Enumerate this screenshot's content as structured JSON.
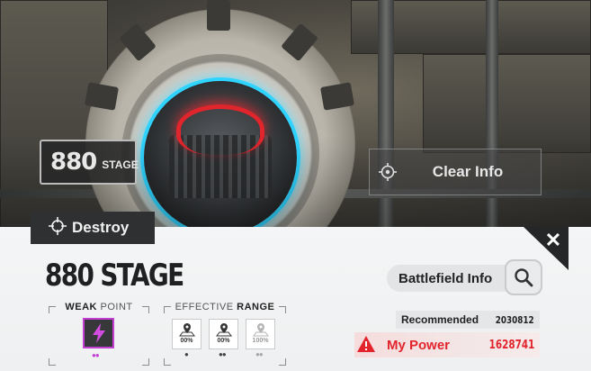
{
  "stage": {
    "number": "880",
    "badge_label": "STAGE",
    "title": "880 STAGE"
  },
  "clear_info": {
    "label": "Clear Info",
    "icon": "crosshair-icon"
  },
  "mode": {
    "label": "Destroy",
    "icon": "target-reticle-icon"
  },
  "close": {
    "label": "✕"
  },
  "weak_point": {
    "title_a": "WEAK",
    "title_b": "POINT",
    "icon": "lightning-icon",
    "accent": "#c33fd3",
    "people": "2"
  },
  "effective_range": {
    "title_a": "EFFECTIVE",
    "title_b": "RANGE",
    "cards": [
      {
        "pct": "00%",
        "people": "1",
        "dim": false
      },
      {
        "pct": "00%",
        "people": "2",
        "dim": false
      },
      {
        "pct": "100%",
        "people": "3",
        "dim": true
      }
    ]
  },
  "battlefield": {
    "label": "Battlefield Info",
    "icon": "search-icon"
  },
  "recommended": {
    "label": "Recommended",
    "value": "2030812"
  },
  "my_power": {
    "label": "My Power",
    "value": "1628741",
    "color": "#e2242c"
  }
}
